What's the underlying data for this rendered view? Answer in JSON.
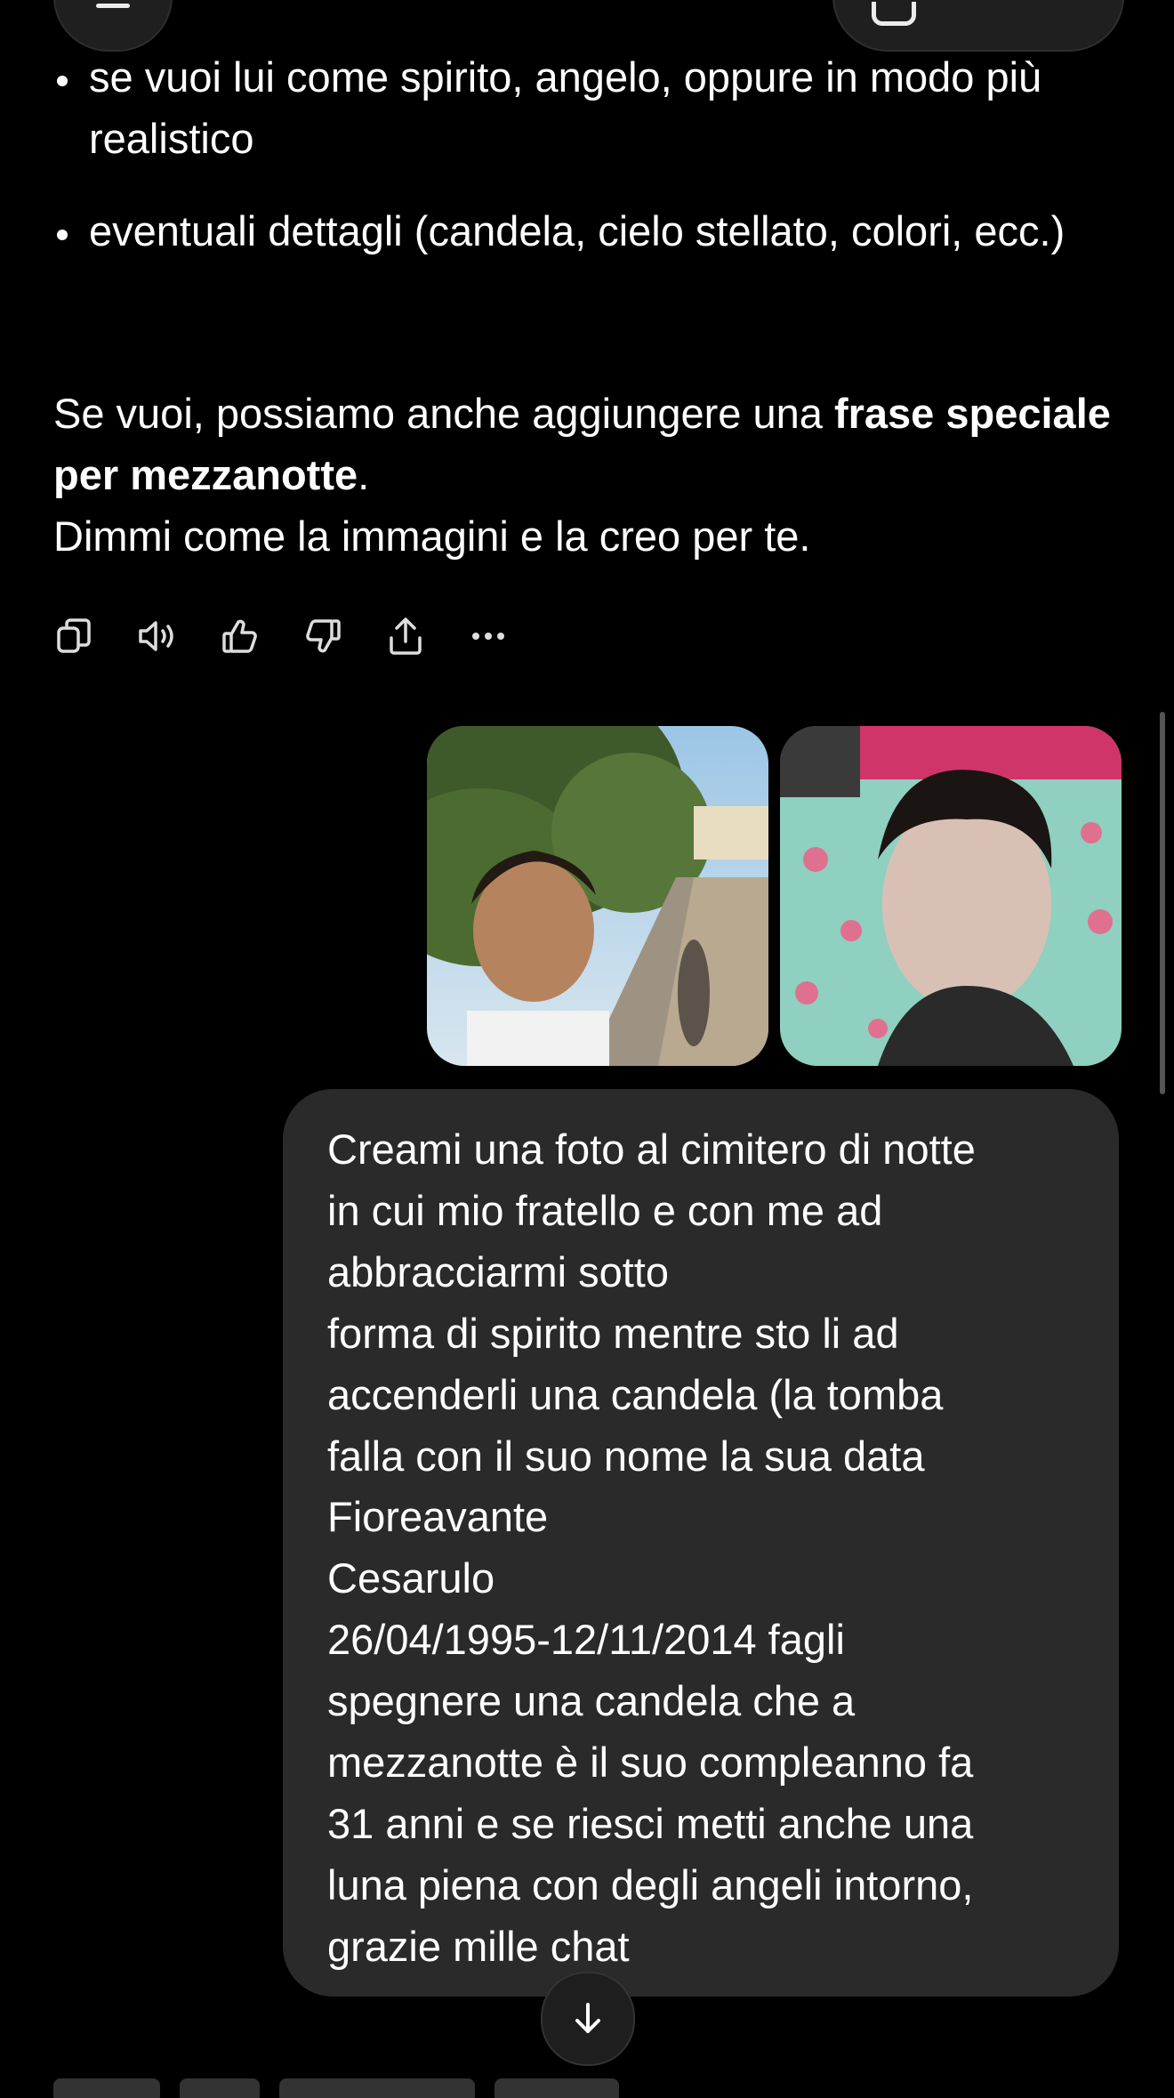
{
  "bullets": [
    "se vuoi lui come spirito, angelo, oppure in modo più realistico",
    "eventuali dettagli (candela, cielo stellato, colori, ecc.)"
  ],
  "response": {
    "line1_before": "Se vuoi, possiamo anche aggiungere una ",
    "line1_bold": "frase speciale per mezzanotte",
    "line1_after": ".",
    "line2": "Dimmi come la immagini e la creo per te."
  },
  "action_icons": [
    "copy-icon",
    "read-aloud-icon",
    "thumbs-up-icon",
    "thumbs-down-icon",
    "share-icon",
    "more-icon"
  ],
  "user_message": {
    "lines": [
      "Creami una foto al cimitero di notte",
      "in cui mio fratello e con me ad",
      "abbracciarmi sotto",
      "forma di spirito mentre sto li ad",
      "accenderli una candela (la tomba",
      "falla con il suo nome la sua data",
      "Fioreavante",
      "Cesarulo",
      "26/04/1995-12/11/2014 fagli",
      "spegnere una candela che a",
      "mezzanotte è il suo compleanno fa",
      "31 anni e se riesci metti anche una",
      "luna piena con degli angeli intorno,",
      "grazie mille chat"
    ]
  },
  "colors": {
    "background": "#000000",
    "bubble": "#2a2a2a",
    "text": "#ffffff"
  }
}
